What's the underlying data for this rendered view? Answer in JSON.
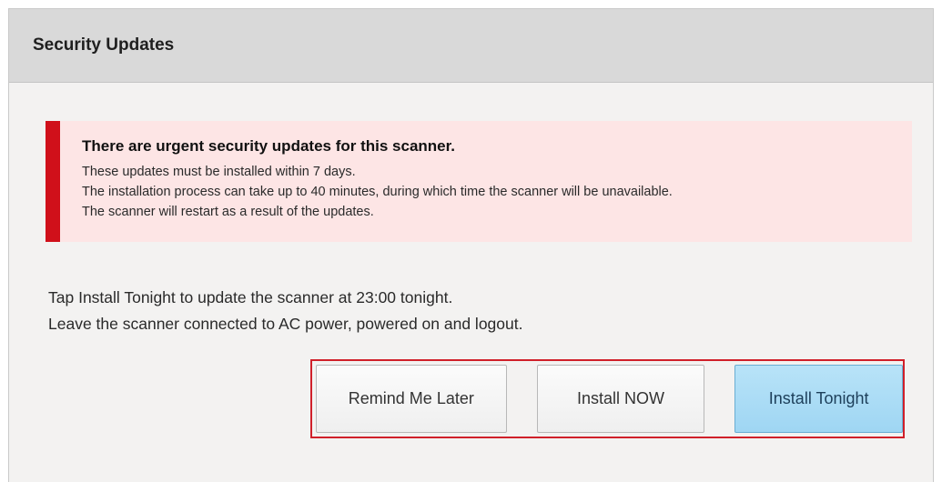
{
  "dialog": {
    "title": "Security Updates"
  },
  "alert": {
    "title": "There are urgent security updates for this scanner.",
    "lines": [
      "These updates must be installed within 7 days.",
      "The installation process can take up to 40 minutes, during which time the scanner will be unavailable.",
      "The scanner will restart as a result of the updates."
    ],
    "accent_color": "#d0101a",
    "background_color": "#fde5e5"
  },
  "instructions": {
    "lines": [
      "Tap Install Tonight to update the scanner at 23:00 tonight.",
      "Leave the scanner connected to AC power, powered on and logout."
    ]
  },
  "buttons": {
    "remind_label": "Remind Me Later",
    "install_now_label": "Install NOW",
    "install_tonight_label": "Install Tonight",
    "highlight_color": "#d0202a",
    "primary_color": "#a9dbf5"
  }
}
